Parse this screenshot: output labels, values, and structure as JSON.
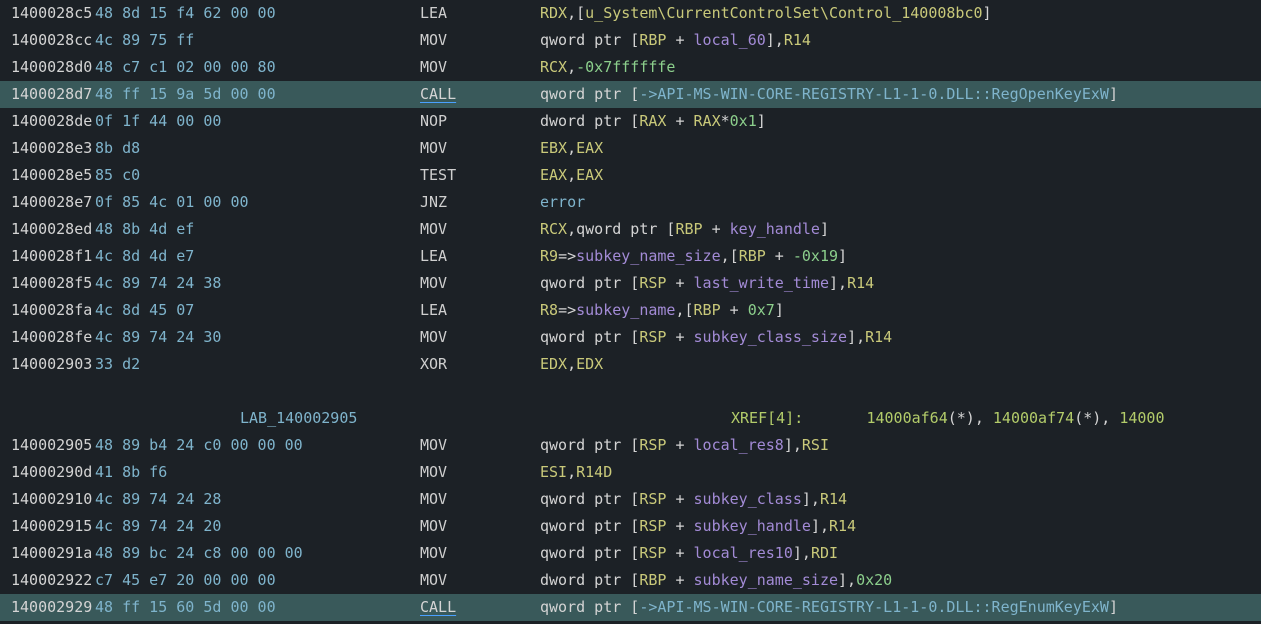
{
  "colors": {
    "background": "#1c2126",
    "highlight_row": "#39595a",
    "address": "#d4d4d4",
    "bytes": "#7fb4cc",
    "register": "#c9c97a",
    "number": "#8ccf8c",
    "variable": "#a38bd6",
    "reference": "#7fb4cc",
    "label": "#7fb4cc",
    "xref": "#b3cc6a"
  },
  "rows": [
    {
      "kind": "insn",
      "addr": "1400028c5",
      "bytes": "48 8d 15 f4 62 00 00",
      "mnem": "LEA",
      "hl": false,
      "ops": [
        {
          "t": "RDX",
          "c": "reg"
        },
        {
          "t": ",[",
          "c": "txt"
        },
        {
          "t": "u_System\\CurrentControlSet\\Control_140008bc0",
          "c": "reg"
        },
        {
          "t": "]",
          "c": "txt"
        }
      ]
    },
    {
      "kind": "insn",
      "addr": "1400028cc",
      "bytes": "4c 89 75 ff",
      "mnem": "MOV",
      "hl": false,
      "ops": [
        {
          "t": "qword ptr [",
          "c": "txt"
        },
        {
          "t": "RBP",
          "c": "reg"
        },
        {
          "t": " + ",
          "c": "txt"
        },
        {
          "t": "local_60",
          "c": "var"
        },
        {
          "t": "],",
          "c": "txt"
        },
        {
          "t": "R14",
          "c": "reg"
        }
      ]
    },
    {
      "kind": "insn",
      "addr": "1400028d0",
      "bytes": "48 c7 c1 02 00 00 80",
      "mnem": "MOV",
      "hl": false,
      "ops": [
        {
          "t": "RCX",
          "c": "reg"
        },
        {
          "t": ",",
          "c": "txt"
        },
        {
          "t": "-0x7ffffffe",
          "c": "num"
        }
      ]
    },
    {
      "kind": "insn",
      "addr": "1400028d7",
      "bytes": "48 ff 15 9a 5d 00 00",
      "mnem": "CALL",
      "hl": true,
      "ops": [
        {
          "t": "qword ptr [",
          "c": "txt"
        },
        {
          "t": "->API-MS-WIN-CORE-REGISTRY-L1-1-0.DLL::RegOpenKeyExW",
          "c": "ref"
        },
        {
          "t": "]",
          "c": "txt"
        }
      ]
    },
    {
      "kind": "insn",
      "addr": "1400028de",
      "bytes": "0f 1f 44 00 00",
      "mnem": "NOP",
      "hl": false,
      "ops": [
        {
          "t": "dword ptr [",
          "c": "txt"
        },
        {
          "t": "RAX",
          "c": "reg"
        },
        {
          "t": " + ",
          "c": "txt"
        },
        {
          "t": "RAX",
          "c": "reg"
        },
        {
          "t": "*",
          "c": "txt"
        },
        {
          "t": "0x1",
          "c": "num"
        },
        {
          "t": "]",
          "c": "txt"
        }
      ]
    },
    {
      "kind": "insn",
      "addr": "1400028e3",
      "bytes": "8b d8",
      "mnem": "MOV",
      "hl": false,
      "ops": [
        {
          "t": "EBX",
          "c": "reg"
        },
        {
          "t": ",",
          "c": "txt"
        },
        {
          "t": "EAX",
          "c": "reg"
        }
      ]
    },
    {
      "kind": "insn",
      "addr": "1400028e5",
      "bytes": "85 c0",
      "mnem": "TEST",
      "hl": false,
      "ops": [
        {
          "t": "EAX",
          "c": "reg"
        },
        {
          "t": ",",
          "c": "txt"
        },
        {
          "t": "EAX",
          "c": "reg"
        }
      ]
    },
    {
      "kind": "insn",
      "addr": "1400028e7",
      "bytes": "0f 85 4c 01 00 00",
      "mnem": "JNZ",
      "hl": false,
      "ops": [
        {
          "t": "error",
          "c": "ref"
        }
      ]
    },
    {
      "kind": "insn",
      "addr": "1400028ed",
      "bytes": "48 8b 4d ef",
      "mnem": "MOV",
      "hl": false,
      "ops": [
        {
          "t": "RCX",
          "c": "reg"
        },
        {
          "t": ",qword ptr [",
          "c": "txt"
        },
        {
          "t": "RBP",
          "c": "reg"
        },
        {
          "t": " + ",
          "c": "txt"
        },
        {
          "t": "key_handle",
          "c": "var"
        },
        {
          "t": "]",
          "c": "txt"
        }
      ]
    },
    {
      "kind": "insn",
      "addr": "1400028f1",
      "bytes": "4c 8d 4d e7",
      "mnem": "LEA",
      "hl": false,
      "ops": [
        {
          "t": "R9",
          "c": "reg"
        },
        {
          "t": "=>",
          "c": "txt"
        },
        {
          "t": "subkey_name_size",
          "c": "var"
        },
        {
          "t": ",[",
          "c": "txt"
        },
        {
          "t": "RBP",
          "c": "reg"
        },
        {
          "t": " + ",
          "c": "txt"
        },
        {
          "t": "-0x19",
          "c": "num"
        },
        {
          "t": "]",
          "c": "txt"
        }
      ]
    },
    {
      "kind": "insn",
      "addr": "1400028f5",
      "bytes": "4c 89 74 24 38",
      "mnem": "MOV",
      "hl": false,
      "ops": [
        {
          "t": "qword ptr [",
          "c": "txt"
        },
        {
          "t": "RSP",
          "c": "reg"
        },
        {
          "t": " + ",
          "c": "txt"
        },
        {
          "t": "last_write_time",
          "c": "var"
        },
        {
          "t": "],",
          "c": "txt"
        },
        {
          "t": "R14",
          "c": "reg"
        }
      ]
    },
    {
      "kind": "insn",
      "addr": "1400028fa",
      "bytes": "4c 8d 45 07",
      "mnem": "LEA",
      "hl": false,
      "ops": [
        {
          "t": "R8",
          "c": "reg"
        },
        {
          "t": "=>",
          "c": "txt"
        },
        {
          "t": "subkey_name",
          "c": "var"
        },
        {
          "t": ",[",
          "c": "txt"
        },
        {
          "t": "RBP",
          "c": "reg"
        },
        {
          "t": " + ",
          "c": "txt"
        },
        {
          "t": "0x7",
          "c": "num"
        },
        {
          "t": "]",
          "c": "txt"
        }
      ]
    },
    {
      "kind": "insn",
      "addr": "1400028fe",
      "bytes": "4c 89 74 24 30",
      "mnem": "MOV",
      "hl": false,
      "ops": [
        {
          "t": "qword ptr [",
          "c": "txt"
        },
        {
          "t": "RSP",
          "c": "reg"
        },
        {
          "t": " + ",
          "c": "txt"
        },
        {
          "t": "subkey_class_size",
          "c": "var"
        },
        {
          "t": "],",
          "c": "txt"
        },
        {
          "t": "R14",
          "c": "reg"
        }
      ]
    },
    {
      "kind": "insn",
      "addr": "140002903",
      "bytes": "33 d2",
      "mnem": "XOR",
      "hl": false,
      "ops": [
        {
          "t": "EDX",
          "c": "reg"
        },
        {
          "t": ",",
          "c": "txt"
        },
        {
          "t": "EDX",
          "c": "reg"
        }
      ]
    },
    {
      "kind": "blank"
    },
    {
      "kind": "label",
      "label": "LAB_140002905",
      "xref": [
        {
          "t": "XREF[4]:       ",
          "c": "xnum"
        },
        {
          "t": "14000af64",
          "c": "xnum"
        },
        {
          "t": "(*), ",
          "c": "txt"
        },
        {
          "t": "14000af74",
          "c": "xnum"
        },
        {
          "t": "(*), ",
          "c": "txt"
        },
        {
          "t": "14000",
          "c": "xnum"
        }
      ]
    },
    {
      "kind": "insn",
      "addr": "140002905",
      "bytes": "48 89 b4 24 c0 00 00 00",
      "mnem": "MOV",
      "hl": false,
      "ops": [
        {
          "t": "qword ptr [",
          "c": "txt"
        },
        {
          "t": "RSP",
          "c": "reg"
        },
        {
          "t": " + ",
          "c": "txt"
        },
        {
          "t": "local_res8",
          "c": "var"
        },
        {
          "t": "],",
          "c": "txt"
        },
        {
          "t": "RSI",
          "c": "reg"
        }
      ]
    },
    {
      "kind": "insn",
      "addr": "14000290d",
      "bytes": "41 8b f6",
      "mnem": "MOV",
      "hl": false,
      "ops": [
        {
          "t": "ESI",
          "c": "reg"
        },
        {
          "t": ",",
          "c": "txt"
        },
        {
          "t": "R14D",
          "c": "reg"
        }
      ]
    },
    {
      "kind": "insn",
      "addr": "140002910",
      "bytes": "4c 89 74 24 28",
      "mnem": "MOV",
      "hl": false,
      "ops": [
        {
          "t": "qword ptr [",
          "c": "txt"
        },
        {
          "t": "RSP",
          "c": "reg"
        },
        {
          "t": " + ",
          "c": "txt"
        },
        {
          "t": "subkey_class",
          "c": "var"
        },
        {
          "t": "],",
          "c": "txt"
        },
        {
          "t": "R14",
          "c": "reg"
        }
      ]
    },
    {
      "kind": "insn",
      "addr": "140002915",
      "bytes": "4c 89 74 24 20",
      "mnem": "MOV",
      "hl": false,
      "ops": [
        {
          "t": "qword ptr [",
          "c": "txt"
        },
        {
          "t": "RSP",
          "c": "reg"
        },
        {
          "t": " + ",
          "c": "txt"
        },
        {
          "t": "subkey_handle",
          "c": "var"
        },
        {
          "t": "],",
          "c": "txt"
        },
        {
          "t": "R14",
          "c": "reg"
        }
      ]
    },
    {
      "kind": "insn",
      "addr": "14000291a",
      "bytes": "48 89 bc 24 c8 00 00 00",
      "mnem": "MOV",
      "hl": false,
      "ops": [
        {
          "t": "qword ptr [",
          "c": "txt"
        },
        {
          "t": "RSP",
          "c": "reg"
        },
        {
          "t": " + ",
          "c": "txt"
        },
        {
          "t": "local_res10",
          "c": "var"
        },
        {
          "t": "],",
          "c": "txt"
        },
        {
          "t": "RDI",
          "c": "reg"
        }
      ]
    },
    {
      "kind": "insn",
      "addr": "140002922",
      "bytes": "c7 45 e7 20 00 00 00",
      "mnem": "MOV",
      "hl": false,
      "ops": [
        {
          "t": "dword ptr [",
          "c": "txt"
        },
        {
          "t": "RBP",
          "c": "reg"
        },
        {
          "t": " + ",
          "c": "txt"
        },
        {
          "t": "subkey_name_size",
          "c": "var"
        },
        {
          "t": "],",
          "c": "txt"
        },
        {
          "t": "0x20",
          "c": "num"
        }
      ]
    },
    {
      "kind": "insn",
      "addr": "140002929",
      "bytes": "48 ff 15 60 5d 00 00",
      "mnem": "CALL",
      "hl": true,
      "ops": [
        {
          "t": "qword ptr [",
          "c": "txt"
        },
        {
          "t": "->API-MS-WIN-CORE-REGISTRY-L1-1-0.DLL::RegEnumKeyExW",
          "c": "ref"
        },
        {
          "t": "]",
          "c": "txt"
        }
      ]
    }
  ]
}
